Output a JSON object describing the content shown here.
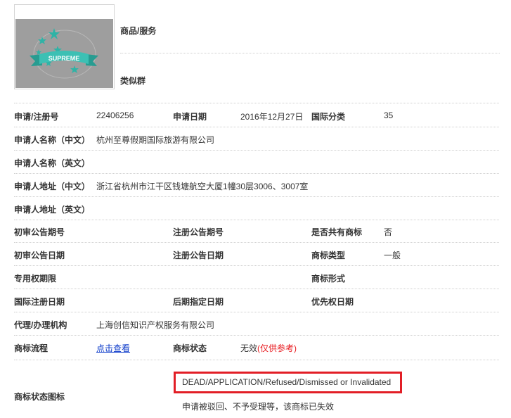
{
  "header": {
    "logo_text": "SUPREME",
    "goods_label": "商品/服务",
    "similar_group_label": "类似群"
  },
  "rows": {
    "r1": {
      "l1": "申请/注册号",
      "v1": "22406256",
      "l2": "申请日期",
      "v2": "2016年12月27日",
      "l3": "国际分类",
      "v3": "35"
    },
    "r2": {
      "l1": "申请人名称（中文）",
      "v1": "杭州至尊假期国际旅游有限公司"
    },
    "r3": {
      "l1": "申请人名称（英文）"
    },
    "r4": {
      "l1": "申请人地址（中文）",
      "v1": "浙江省杭州市江干区钱塘航空大厦1幢30层3006、3007室"
    },
    "r5": {
      "l1": "申请人地址（英文）"
    },
    "r6": {
      "l1": "初审公告期号",
      "l2": "注册公告期号",
      "l3": "是否共有商标",
      "v3": "否"
    },
    "r7": {
      "l1": "初审公告日期",
      "l2": "注册公告日期",
      "l3": "商标类型",
      "v3": "一般"
    },
    "r8": {
      "l1": "专用权期限",
      "l3": "商标形式"
    },
    "r9": {
      "l1": "国际注册日期",
      "l2": "后期指定日期",
      "l3": "优先权日期"
    },
    "r10": {
      "l1": "代理/办理机构",
      "v1": "上海创信知识产权服务有限公司"
    },
    "r11": {
      "l1": "商标流程",
      "link": "点击查看",
      "l2": "商标状态",
      "v2": "无效",
      "v2_note": "(仅供参考)"
    }
  },
  "status_icon": {
    "label": "商标状态图标",
    "en_text": "DEAD/APPLICATION/Refused/Dismissed or Invalidated",
    "cn_text": "申请被驳回、不予受理等，该商标已失效"
  },
  "colors": {
    "highlight_border": "#e21e26",
    "link": "#0a38c9",
    "note": "#e8191e",
    "logo_bg": "#9e9e9e",
    "ribbon": "#3cc0b4"
  }
}
